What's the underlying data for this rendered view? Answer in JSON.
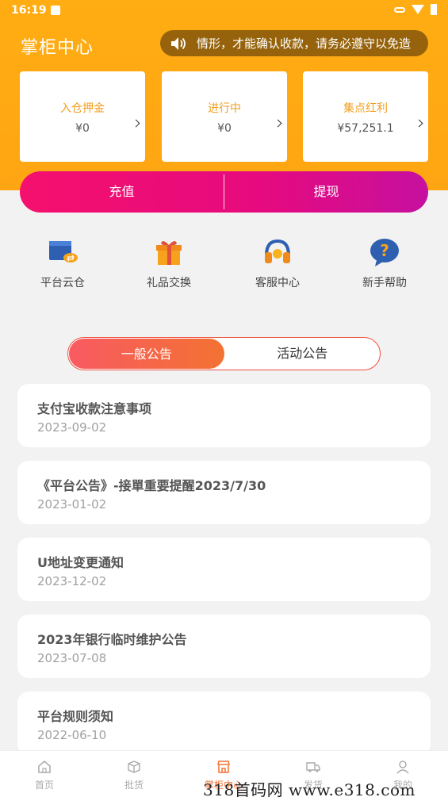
{
  "status_bar": {
    "time": "16:19"
  },
  "header": {
    "title": "掌柜中心",
    "notice": "情形，才能确认收款，请务必遵守以免造"
  },
  "stats": [
    {
      "label": "入仓押金",
      "value": "¥0"
    },
    {
      "label": "进行中",
      "value": "¥0"
    },
    {
      "label": "集点红利",
      "value": "¥57,251.1"
    }
  ],
  "actions": {
    "recharge": "充值",
    "withdraw": "提现"
  },
  "quick_links": [
    {
      "label": "平台云仓",
      "icon": "warehouse-icon"
    },
    {
      "label": "礼品交换",
      "icon": "gift-icon"
    },
    {
      "label": "客服中心",
      "icon": "headset-icon"
    },
    {
      "label": "新手帮助",
      "icon": "help-icon"
    }
  ],
  "tabs": {
    "general": "一般公告",
    "activity": "活动公告",
    "active": "general"
  },
  "notices": [
    {
      "title": "支付宝收款注意事项",
      "date": "2023-09-02"
    },
    {
      "title": "《平台公告》-接單重要提醒2023/7/30",
      "date": "2023-01-02"
    },
    {
      "title": "U地址变更通知",
      "date": "2023-12-02"
    },
    {
      "title": "2023年银行临时维护公告",
      "date": "2023-07-08"
    },
    {
      "title": "平台规则须知",
      "date": "2022-06-10"
    }
  ],
  "tabbar": [
    {
      "label": "首页",
      "icon": "home-icon"
    },
    {
      "label": "批货",
      "icon": "box-icon"
    },
    {
      "label": "掌柜中心",
      "icon": "store-icon"
    },
    {
      "label": "发货",
      "icon": "truck-icon"
    },
    {
      "label": "我的",
      "icon": "user-icon"
    }
  ],
  "watermark": "318首码网 www.e318.com",
  "colors": {
    "accent": "#ffa513",
    "action": "#f5106d",
    "tab_active": "#f37232"
  }
}
